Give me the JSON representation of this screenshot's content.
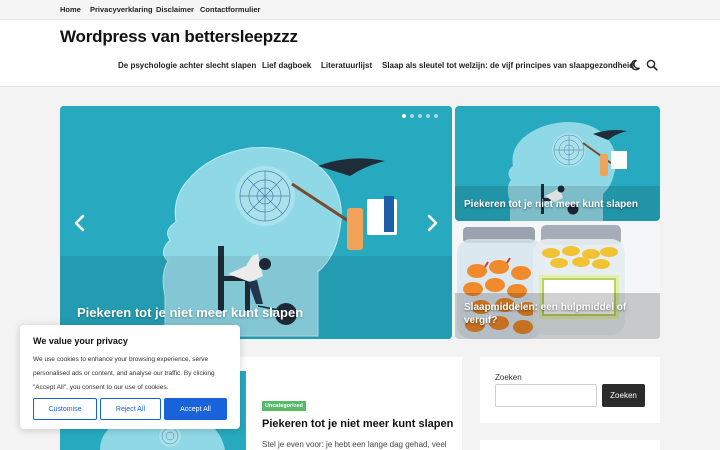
{
  "topbar": {
    "links": [
      "Home",
      "Privacyverklaring",
      "Disclaimer",
      "Contactformulier"
    ]
  },
  "header": {
    "site_title": "Wordpress van bettersleepzzz",
    "nav": [
      "De psychologie achter slecht slapen",
      "Lief dagboek",
      "Literatuurlijst",
      "Slaap als sleutel tot welzijn: de vijf principes van slaapgezondheid"
    ],
    "icons": [
      "dark-mode-moon-icon",
      "search-icon"
    ]
  },
  "slider": {
    "title": "Piekeren tot je niet meer kunt slapen",
    "dot_count": 5,
    "active_dot": 0,
    "icons": [
      "chevron-left-icon",
      "chevron-right-icon"
    ]
  },
  "side_cards": [
    {
      "title": "Piekeren tot je niet meer kunt slapen"
    },
    {
      "title": "Slaapmiddelen: een hulpmiddel of vergif?"
    }
  ],
  "post": {
    "category": "Uncategorized",
    "title": "Piekeren tot je niet meer kunt slapen",
    "excerpt": "Stel je even voor: je hebt een lange dag gehad, veel"
  },
  "sidebar": {
    "search_label": "Zoeken",
    "search_value": "",
    "search_button": "Zoeken"
  },
  "cookie": {
    "title": "We value your privacy",
    "text": "We use cookies to enhance your browsing experience, serve personalised ads or content, and analyse our traffic. By clicking \"Accept All\", you consent to our use of cookies.",
    "customise": "Customise",
    "reject": "Reject All",
    "accept": "Accept All"
  },
  "colors": {
    "accent": "#1863dc",
    "badge": "#58b96b",
    "hero_bg": "#27a9bf"
  }
}
